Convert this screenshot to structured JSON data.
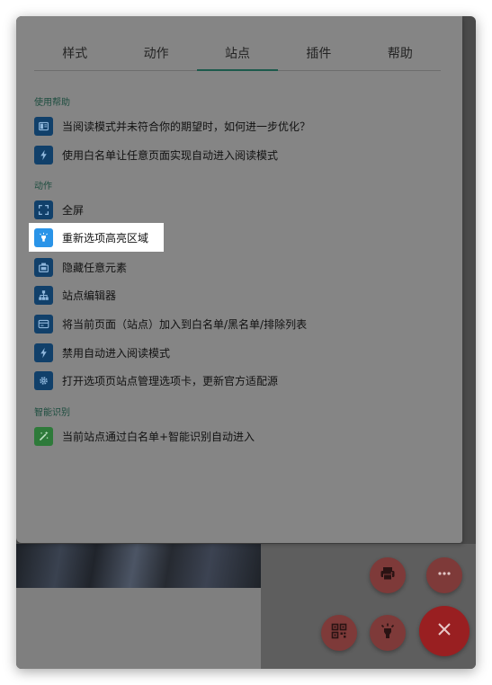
{
  "tabs": [
    {
      "label": "样式",
      "active": false
    },
    {
      "label": "动作",
      "active": false
    },
    {
      "label": "站点",
      "active": true
    },
    {
      "label": "插件",
      "active": false
    },
    {
      "label": "帮助",
      "active": false
    }
  ],
  "sections": {
    "help": {
      "title": "使用帮助",
      "items": [
        {
          "label": "当阅读模式并未符合你的期望时，如何进一步优化？",
          "icon": "reader-icon"
        },
        {
          "label": "使用白名单让任意页面实现自动进入阅读模式",
          "icon": "lightning-icon"
        }
      ]
    },
    "actions": {
      "title": "动作",
      "items": [
        {
          "label": "全屏",
          "icon": "fullscreen-icon"
        },
        {
          "label": "重新选项高亮区域",
          "icon": "highlight-bulb-icon"
        },
        {
          "label": "隐藏任意元素",
          "icon": "hide-element-icon"
        },
        {
          "label": "站点编辑器",
          "icon": "sitemap-icon"
        },
        {
          "label": "将当前页面（站点）加入到白名单/黑名单/排除列表",
          "icon": "list-card-icon"
        },
        {
          "label": "禁用自动进入阅读模式",
          "icon": "lightning-icon"
        },
        {
          "label": "打开选项页站点管理选项卡，更新官方适配源",
          "icon": "gear-icon"
        }
      ]
    },
    "smart": {
      "title": "智能识别",
      "items": [
        {
          "label": "当前站点通过白名单+智能识别自动进入",
          "icon": "magic-wand-icon"
        }
      ]
    }
  },
  "fab": {
    "print": "print-icon",
    "more": "more-icon",
    "qrcode": "qrcode-icon",
    "highlight": "bulb-icon",
    "close": "close-icon"
  },
  "colors": {
    "accent": "#1c5a4c",
    "icon_blue": "#11406a",
    "icon_active": "#2a94e8",
    "icon_green": "#2e7a3a",
    "fab": "#7e3a39",
    "fab_close": "#991f21"
  }
}
